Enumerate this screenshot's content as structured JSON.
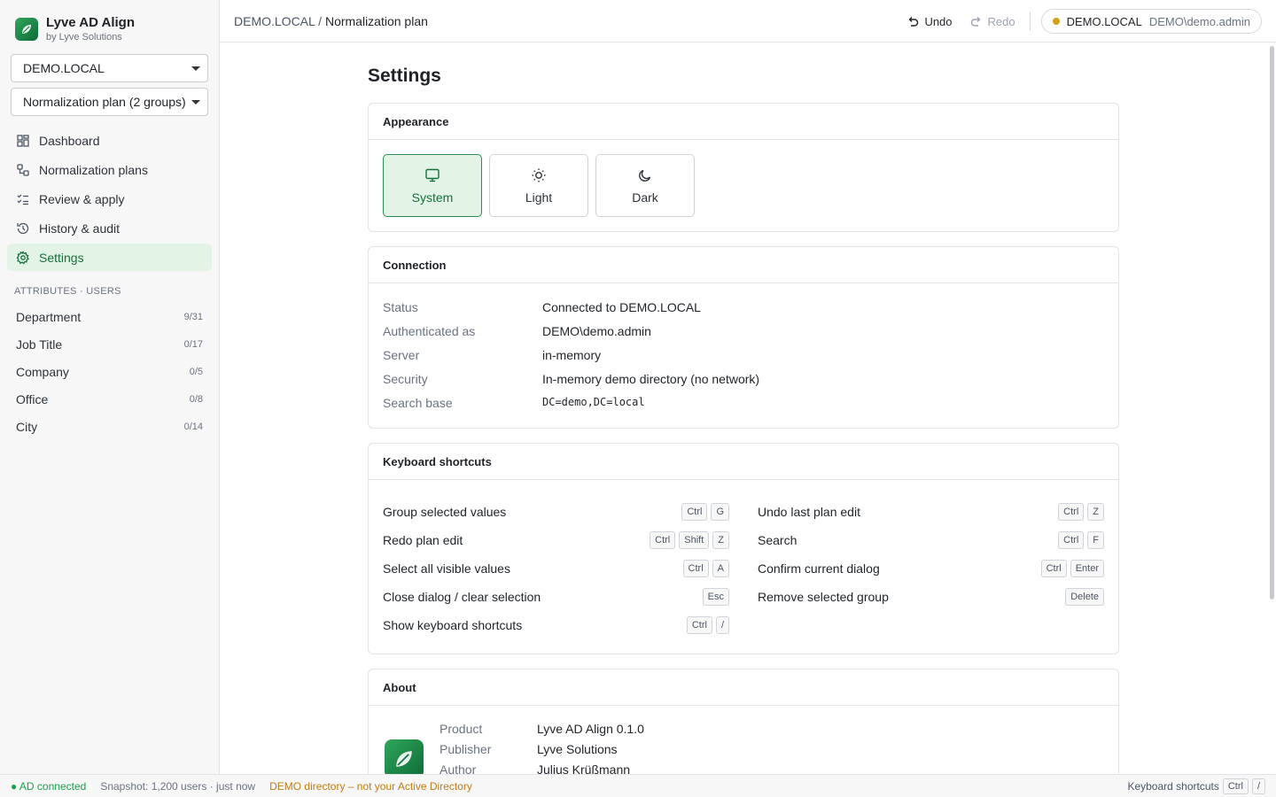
{
  "app": {
    "name": "Lyve AD Align",
    "subtitle": "by Lyve Solutions"
  },
  "sidebar": {
    "domain_select": "DEMO.LOCAL",
    "plan_select": "Normalization plan (2 groups)",
    "nav": [
      {
        "label": "Dashboard",
        "icon": "dashboard-icon"
      },
      {
        "label": "Normalization plans",
        "icon": "plans-icon"
      },
      {
        "label": "Review & apply",
        "icon": "checklist-icon"
      },
      {
        "label": "History & audit",
        "icon": "history-icon"
      },
      {
        "label": "Settings",
        "icon": "gear-icon",
        "active": true
      }
    ],
    "section_label": "ATTRIBUTES · USERS",
    "attributes": [
      {
        "label": "Department",
        "count": "9/31"
      },
      {
        "label": "Job Title",
        "count": "0/17"
      },
      {
        "label": "Company",
        "count": "0/5"
      },
      {
        "label": "Office",
        "count": "0/8"
      },
      {
        "label": "City",
        "count": "0/14"
      }
    ]
  },
  "topbar": {
    "breadcrumb_root": "DEMO.LOCAL",
    "breadcrumb_sep": "/",
    "breadcrumb_current": "Normalization plan",
    "undo_label": "Undo",
    "redo_label": "Redo",
    "conn_domain": "DEMO.LOCAL",
    "conn_user": "DEMO\\demo.admin"
  },
  "page": {
    "title": "Settings",
    "appearance": {
      "title": "Appearance",
      "options": [
        {
          "label": "System",
          "active": true
        },
        {
          "label": "Light"
        },
        {
          "label": "Dark"
        }
      ]
    },
    "connection": {
      "title": "Connection",
      "rows": [
        {
          "k": "Status",
          "v": "Connected to DEMO.LOCAL"
        },
        {
          "k": "Authenticated as",
          "v": "DEMO\\demo.admin"
        },
        {
          "k": "Server",
          "v": "in-memory"
        },
        {
          "k": "Security",
          "v": "In-memory demo directory (no network)"
        },
        {
          "k": "Search base",
          "v": "DC=demo,DC=local"
        }
      ]
    },
    "shortcuts": {
      "title": "Keyboard shortcuts",
      "left": [
        {
          "label": "Group selected values",
          "keys": [
            "Ctrl",
            "G"
          ]
        },
        {
          "label": "Redo plan edit",
          "keys": [
            "Ctrl",
            "Shift",
            "Z"
          ]
        },
        {
          "label": "Select all visible values",
          "keys": [
            "Ctrl",
            "A"
          ]
        },
        {
          "label": "Close dialog / clear selection",
          "keys": [
            "Esc"
          ]
        },
        {
          "label": "Show keyboard shortcuts",
          "keys": [
            "Ctrl",
            "/"
          ]
        }
      ],
      "right": [
        {
          "label": "Undo last plan edit",
          "keys": [
            "Ctrl",
            "Z"
          ]
        },
        {
          "label": "Search",
          "keys": [
            "Ctrl",
            "F"
          ]
        },
        {
          "label": "Confirm current dialog",
          "keys": [
            "Ctrl",
            "Enter"
          ]
        },
        {
          "label": "Remove selected group",
          "keys": [
            "Delete"
          ]
        }
      ]
    },
    "about": {
      "title": "About",
      "rows": [
        {
          "k": "Product",
          "v": "Lyve AD Align 0.1.0"
        },
        {
          "k": "Publisher",
          "v": "Lyve Solutions"
        },
        {
          "k": "Author",
          "v": "Julius Krüßmann"
        }
      ]
    }
  },
  "statusbar": {
    "connected": "● AD connected",
    "snapshot": "Snapshot: 1,200 users · just now",
    "warning": "DEMO directory – not your Active Directory",
    "shortcuts_label": "Keyboard shortcuts",
    "shortcut_keys": [
      "Ctrl",
      "/"
    ]
  },
  "colors": {
    "accent": "#16703b",
    "accent_bg": "#e3f3e6",
    "warning": "#c27c0e",
    "ok": "#16a34a"
  }
}
